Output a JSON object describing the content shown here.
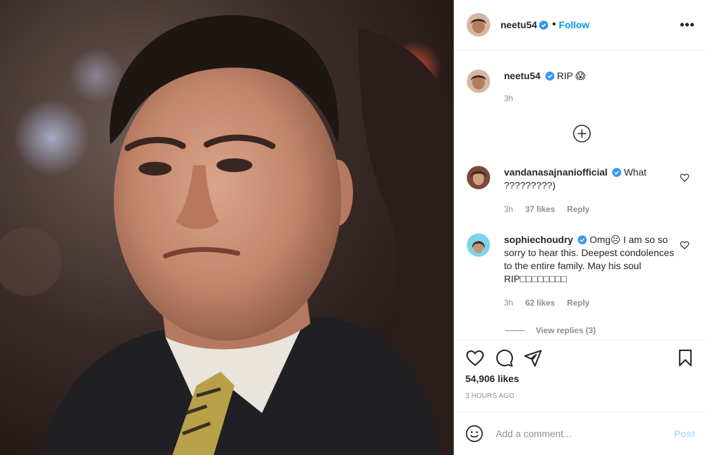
{
  "header": {
    "username": "neetu54",
    "follow_label": "Follow",
    "more_label": "•••"
  },
  "caption": {
    "username": "neetu54",
    "text": "RIP 😱",
    "time": "3h"
  },
  "comments": [
    {
      "username": "vandanasajnaniofficial",
      "text": "What ?????????)",
      "time": "3h",
      "likes": "37 likes",
      "reply": "Reply"
    },
    {
      "username": "sophiechoudry",
      "text": "Omg☹ I am so so sorry to hear this. Deepest condolences to the entire family. May his soul RIP□□□□□□□□",
      "time": "3h",
      "likes": "62 likes",
      "reply": "Reply"
    }
  ],
  "view_replies": "View replies (3)",
  "likes_count": "54,906 likes",
  "posted_ago": "3 HOURS AGO",
  "add_comment": {
    "placeholder": "Add a comment...",
    "post_label": "Post"
  },
  "colors": {
    "accent": "#0095f6",
    "post_disabled": "#b2dffc",
    "verified": "#3897f0",
    "muted": "#8e8e8e"
  }
}
